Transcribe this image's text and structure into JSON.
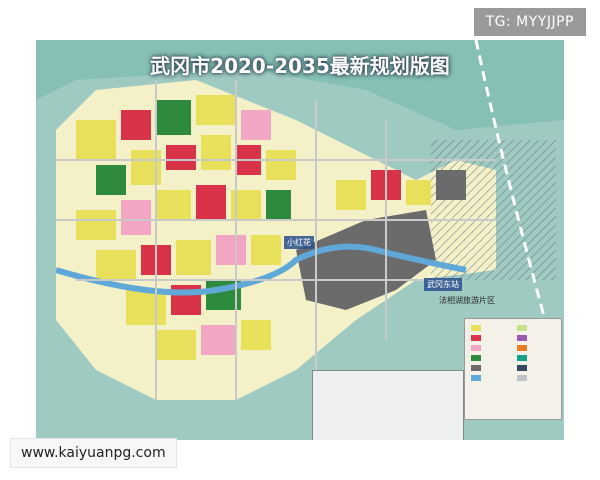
{
  "watermark": {
    "text": "TG: MYYJJPP"
  },
  "footer": {
    "url": "www.kaiyuanpg.com"
  },
  "map": {
    "title": "武冈市2020-2035最新规划版图",
    "labels": {
      "xiaohongjiang": "小红花",
      "wugang_dong": "武冈东站",
      "xinzhan": "法相湖旅游片区"
    }
  },
  "colors": {
    "water": "#7fb6b0",
    "residential": "#e8e05a",
    "commercial": "#d9334a",
    "industrial": "#6b6b6b",
    "green": "#2e8b3e",
    "public": "#f3a6c4",
    "river": "#5fa8d8"
  }
}
